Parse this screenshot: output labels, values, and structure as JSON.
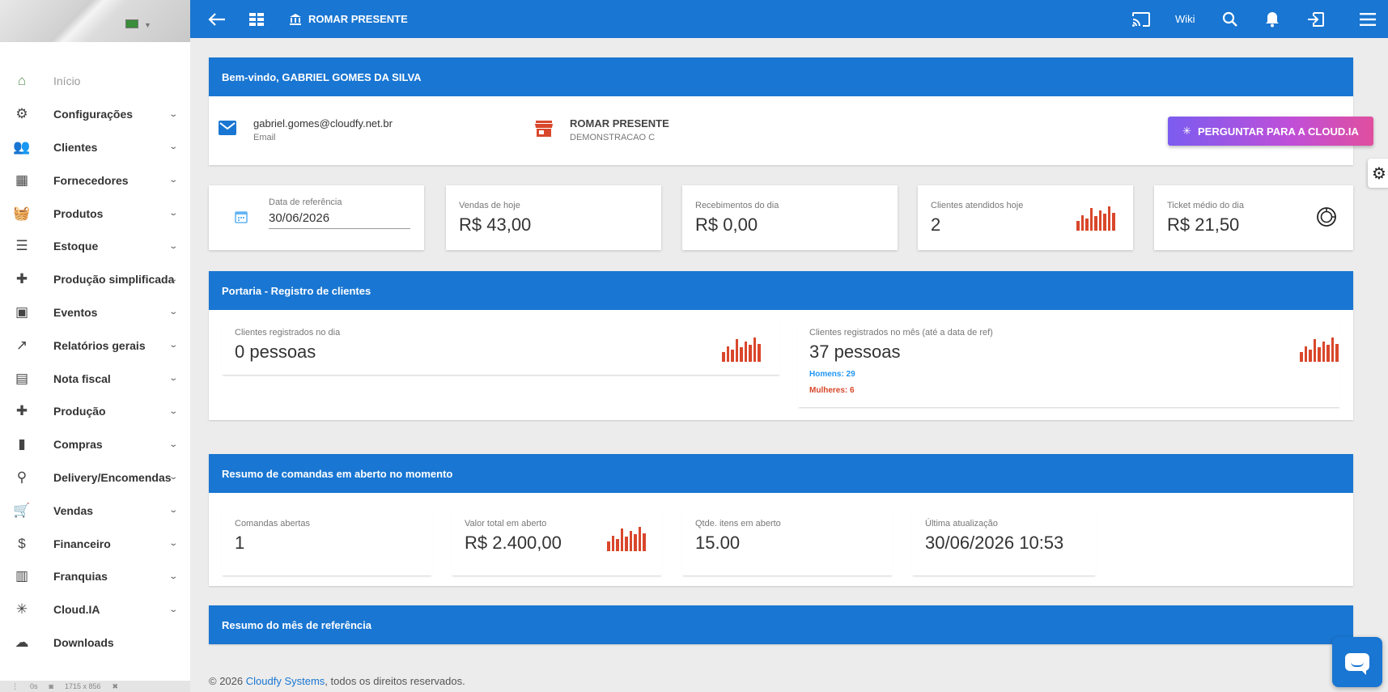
{
  "topbar": {
    "company": "ROMAR PRESENTE",
    "wiki_label": "Wiki"
  },
  "sidebar": {
    "items": [
      {
        "label": "Início",
        "icon": "home-icon",
        "chevron": false
      },
      {
        "label": "Configurações",
        "icon": "settings-icon",
        "chevron": true
      },
      {
        "label": "Clientes",
        "icon": "people-icon",
        "chevron": true
      },
      {
        "label": "Fornecedores",
        "icon": "building-icon",
        "chevron": true
      },
      {
        "label": "Produtos",
        "icon": "basket-icon",
        "chevron": true
      },
      {
        "label": "Estoque",
        "icon": "list-icon",
        "chevron": true
      },
      {
        "label": "Produção simplificada",
        "icon": "puzzle-icon",
        "chevron": true
      },
      {
        "label": "Eventos",
        "icon": "calendar-icon",
        "chevron": true
      },
      {
        "label": "Relatórios gerais",
        "icon": "trending-icon",
        "chevron": true
      },
      {
        "label": "Nota fiscal",
        "icon": "card-icon",
        "chevron": true
      },
      {
        "label": "Produção",
        "icon": "puzzle-icon",
        "chevron": true
      },
      {
        "label": "Compras",
        "icon": "briefcase-icon",
        "chevron": true
      },
      {
        "label": "Delivery/Encomendas",
        "icon": "motorcycle-icon",
        "chevron": true
      },
      {
        "label": "Vendas",
        "icon": "cart-icon",
        "chevron": true
      },
      {
        "label": "Financeiro",
        "icon": "dollar-icon",
        "chevron": true
      },
      {
        "label": "Franquias",
        "icon": "store-icon",
        "chevron": true
      },
      {
        "label": "Cloud.IA",
        "icon": "sparkle-icon",
        "chevron": true
      },
      {
        "label": "Downloads",
        "icon": "cloud-download-icon",
        "chevron": false
      }
    ],
    "bottom_bar": {
      "time": "0s",
      "size": "1715 x 856"
    }
  },
  "welcome": {
    "title": "Bem-vindo, GABRIEL GOMES DA SILVA",
    "email": "gabriel.gomes@cloudfy.net.br",
    "email_label": "Email",
    "store": "ROMAR PRESENTE",
    "store_sub": "DEMONSTRACAO C",
    "cloud_button": "PERGUNTAR PARA A CLOUD.IA"
  },
  "stats": {
    "ref_date_label": "Data de referência",
    "ref_date": "30/06/2026",
    "sales_label": "Vendas de hoje",
    "sales_value": "R$ 43,00",
    "receipts_label": "Recebimentos do dia",
    "receipts_value": "R$ 0,00",
    "clients_label": "Clientes atendidos hoje",
    "clients_value": "2",
    "ticket_label": "Ticket médio do dia",
    "ticket_value": "R$ 21,50"
  },
  "portaria": {
    "title": "Portaria - Registro de clientes",
    "day_label": "Clientes registrados no dia",
    "day_value": "0 pessoas",
    "month_label": "Clientes registrados no mês (até a data de ref)",
    "month_value": "37 pessoas",
    "men": "Homens: 29",
    "women": "Mulheres: 6"
  },
  "comandas": {
    "title": "Resumo de comandas em aberto no momento",
    "open_label": "Comandas abertas",
    "open_value": "1",
    "total_label": "Valor total em aberto",
    "total_value": "R$ 2.400,00",
    "items_label": "Qtde. itens em aberto",
    "items_value": "15.00",
    "updated_label": "Última atualização",
    "updated_value": "30/06/2026 10:53"
  },
  "month_summary": {
    "title": "Resumo do mês de referência"
  },
  "footer": {
    "prefix": "© 2026",
    "link": "Cloudfy Systems",
    "suffix": ", todos os direitos reservados."
  },
  "colors": {
    "primary": "#1976d2",
    "accent_red": "#d9472b",
    "men_blue": "#2196f3"
  }
}
